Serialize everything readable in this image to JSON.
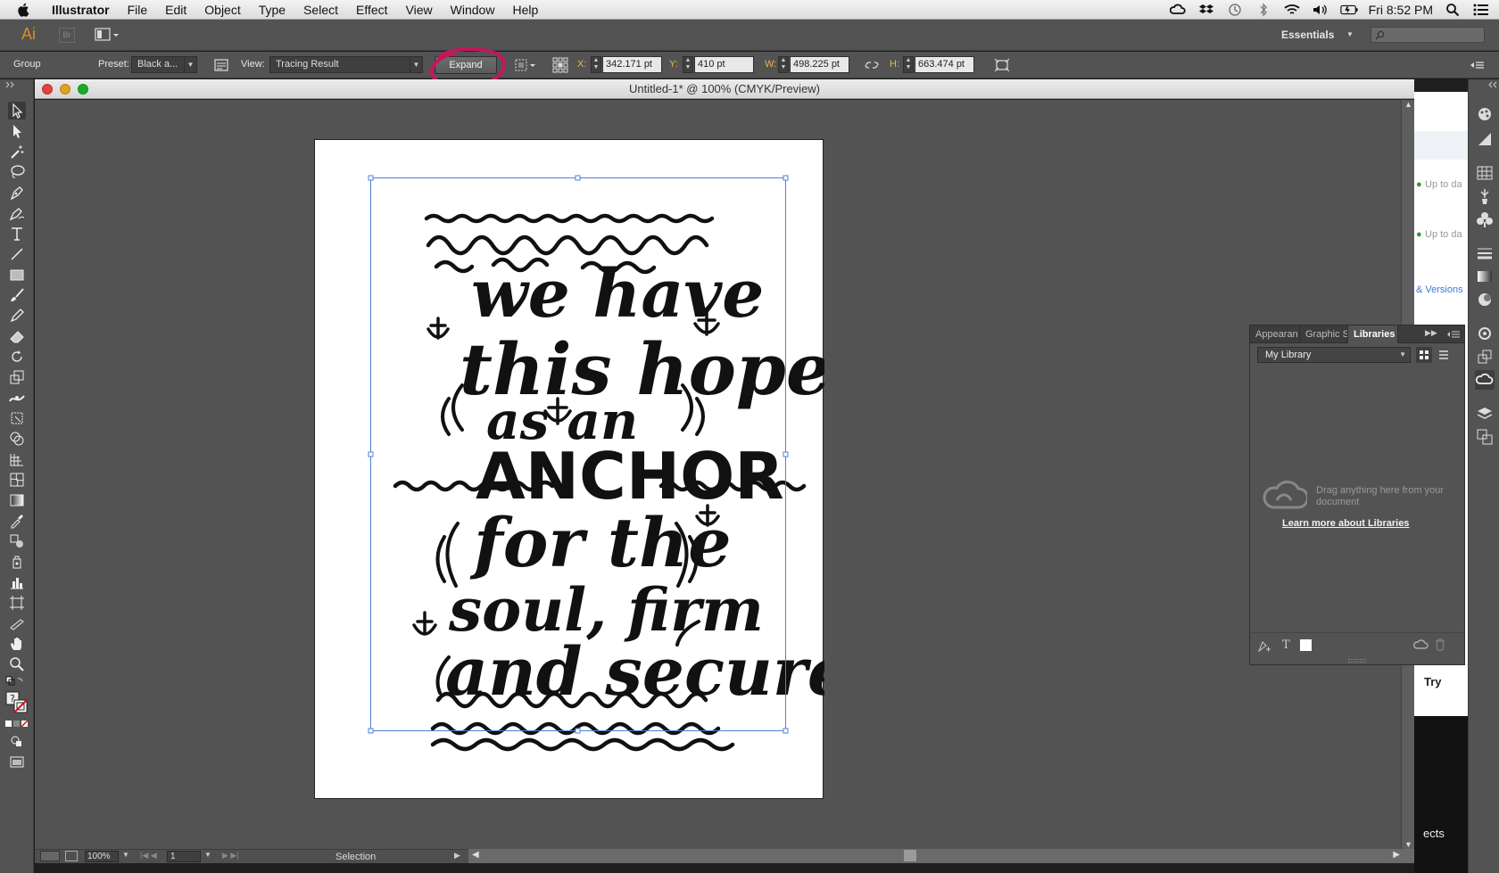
{
  "menubar": {
    "app_name": "Illustrator",
    "items": [
      "File",
      "Edit",
      "Object",
      "Type",
      "Select",
      "Effect",
      "View",
      "Window",
      "Help"
    ],
    "clock": "Fri 8:52 PM"
  },
  "appbar": {
    "logo": "Ai",
    "bridge": "Br",
    "workspace": "Essentials"
  },
  "control": {
    "selection_type": "Group",
    "preset_label": "Preset:",
    "preset_value": "Black a...",
    "view_label": "View:",
    "view_value": "Tracing Result",
    "expand_label": "Expand",
    "x_label": "X:",
    "x_value": "342.171 pt",
    "y_label": "Y:",
    "y_value": "410 pt",
    "w_label": "W:",
    "w_value": "498.225 pt",
    "h_label": "H:",
    "h_value": "663.474 pt",
    "highlight_color": "#c2185b"
  },
  "document": {
    "title": "Untitled-1* @ 100% (CMYK/Preview)",
    "artwork_lines": [
      "we have",
      "this hope",
      "as an",
      "ANCHOR",
      "for the",
      "soul, firm",
      "and secure"
    ]
  },
  "status": {
    "zoom": "100%",
    "artboard": "1",
    "tool": "Selection"
  },
  "libraries": {
    "tabs": [
      "Appearan",
      "Graphic St",
      "Libraries"
    ],
    "library_name": "My Library",
    "empty_text": "Drag anything here from your document",
    "learn_link": "Learn more about Libraries"
  },
  "background_app": {
    "status1": "Up to da",
    "status2": "Up to da",
    "versions": "& Versions",
    "try": "Try",
    "bottom_text": "ects"
  }
}
